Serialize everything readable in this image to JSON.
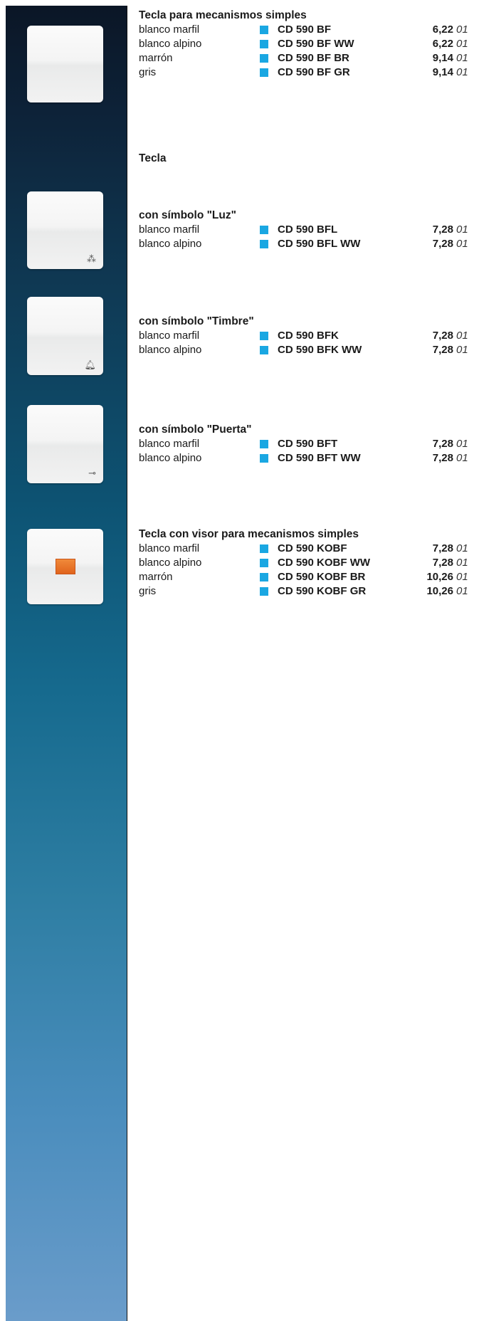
{
  "thumbnails": [
    {
      "name": "switch-plate-plain",
      "glyph": ""
    },
    {
      "name": "switch-plate-light",
      "glyph": "⁂"
    },
    {
      "name": "switch-plate-bell",
      "glyph": "🔔︎"
    },
    {
      "name": "switch-plate-key",
      "glyph": "⊸"
    },
    {
      "name": "switch-plate-visor",
      "glyph": ""
    }
  ],
  "marker_color": "#1aa7e2",
  "sections": [
    {
      "heading": "Tecla para mecanismos simples",
      "rows": [
        {
          "variant": "blanco marfil",
          "code": "CD 590 BF",
          "price": "6,22",
          "pack": "01"
        },
        {
          "variant": "blanco alpino",
          "code": "CD 590 BF WW",
          "price": "6,22",
          "pack": "01"
        },
        {
          "variant": "marrón",
          "code": "CD 590 BF BR",
          "price": "9,14",
          "pack": "01"
        },
        {
          "variant": "gris",
          "code": "CD 590 BF GR",
          "price": "9,14",
          "pack": "01"
        }
      ]
    },
    {
      "heading": "Tecla",
      "rows": []
    },
    {
      "heading": "con símbolo \"Luz\"",
      "rows": [
        {
          "variant": "blanco marfil",
          "code": "CD 590 BFL",
          "price": "7,28",
          "pack": "01"
        },
        {
          "variant": "blanco alpino",
          "code": "CD 590 BFL WW",
          "price": "7,28",
          "pack": "01"
        }
      ]
    },
    {
      "heading": "con símbolo \"Timbre\"",
      "rows": [
        {
          "variant": "blanco marfil",
          "code": "CD 590 BFK",
          "price": "7,28",
          "pack": "01"
        },
        {
          "variant": "blanco alpino",
          "code": "CD 590 BFK WW",
          "price": "7,28",
          "pack": "01"
        }
      ]
    },
    {
      "heading": "con símbolo \"Puerta\"",
      "rows": [
        {
          "variant": "blanco marfil",
          "code": "CD 590 BFT",
          "price": "7,28",
          "pack": "01"
        },
        {
          "variant": "blanco alpino",
          "code": "CD 590 BFT WW",
          "price": "7,28",
          "pack": "01"
        }
      ]
    },
    {
      "heading": "Tecla con visor para mecanismos simples",
      "rows": [
        {
          "variant": "blanco marfil",
          "code": "CD 590 KOBF",
          "price": "7,28",
          "pack": "01"
        },
        {
          "variant": "blanco alpino",
          "code": "CD 590 KOBF WW",
          "price": "7,28",
          "pack": "01"
        },
        {
          "variant": "marrón",
          "code": "CD 590 KOBF BR",
          "price": "10,26",
          "pack": "01"
        },
        {
          "variant": "gris",
          "code": "CD 590 KOBF GR",
          "price": "10,26",
          "pack": "01"
        }
      ]
    }
  ]
}
